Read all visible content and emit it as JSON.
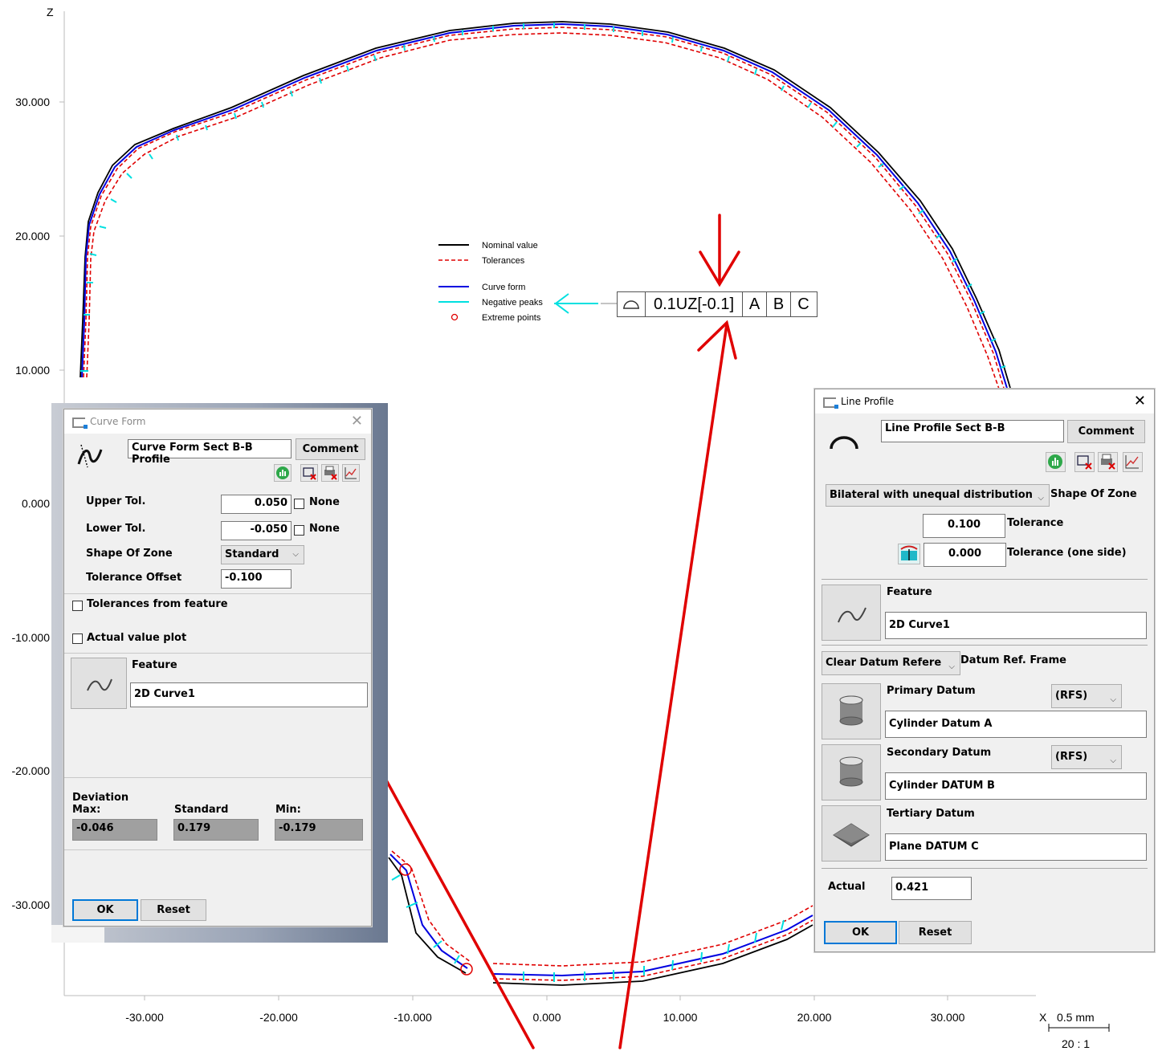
{
  "plot": {
    "axis_z_label": "Z",
    "axis_x_label": "X",
    "y_ticks": [
      "30.000",
      "20.000",
      "10.000",
      "0.000",
      "-10.000",
      "-20.000",
      "-30.000"
    ],
    "x_ticks": [
      "-30.000",
      "-20.000",
      "-10.000",
      "0.000",
      "10.000",
      "20.000",
      "30.000"
    ],
    "scale_bar_label": "0.5 mm",
    "scale_ratio": "20 : 1",
    "legend": [
      {
        "label": "Nominal value",
        "color": "#000000",
        "style": "solid"
      },
      {
        "label": "Tolerances",
        "color": "#e00000",
        "style": "dashed"
      },
      {
        "label": "Curve form",
        "color": "#0000e0",
        "style": "solid"
      },
      {
        "label": "Negative peaks",
        "color": "#00e0e0",
        "style": "solid"
      },
      {
        "label": "Extreme points",
        "color": "#e00000",
        "style": "circle"
      }
    ],
    "fcf": {
      "symbol": "profile-of-line-icon",
      "tolerance": "0.1UZ[-0.1]",
      "datums": [
        "A",
        "B",
        "C"
      ]
    },
    "annotation_color": "#e00000",
    "cyan_arrow_color": "#00e0e0"
  },
  "curve_form": {
    "title": "Curve Form",
    "name": "Curve Form Sect B-B Profile",
    "comment_label": "Comment",
    "upper_tol_label": "Upper Tol.",
    "upper_tol_value": "0.050",
    "lower_tol_label": "Lower Tol.",
    "lower_tol_value": "-0.050",
    "none_label": "None",
    "shape_of_zone_label": "Shape Of Zone",
    "shape_of_zone_value": "Standard",
    "tolerance_offset_label": "Tolerance Offset",
    "tolerance_offset_value": "-0.100",
    "tol_from_feature_label": "Tolerances from feature",
    "actual_plot_label": "Actual value plot",
    "feature_label": "Feature",
    "feature_value": "2D Curve1",
    "deviation_label": "Deviation",
    "max_label": "Max:",
    "std_label": "Standard",
    "min_label": "Min:",
    "max_value": "-0.046",
    "std_value": "0.179",
    "min_value": "-0.179",
    "ok_label": "OK",
    "reset_label": "Reset"
  },
  "line_profile": {
    "title": "Line Profile",
    "name": "Line Profile Sect B-B",
    "comment_label": "Comment",
    "zone_type": "Bilateral with unequal distribution",
    "shape_of_zone_label": "Shape Of Zone",
    "tolerance_value": "0.100",
    "tolerance_label": "Tolerance",
    "tolerance_one_side_value": "0.000",
    "tolerance_one_side_label": "Tolerance (one side)",
    "feature_label": "Feature",
    "feature_value": "2D Curve1",
    "clear_datum_label": "Clear Datum Refere",
    "datum_ref_frame_label": "Datum Ref. Frame",
    "primary_label": "Primary Datum",
    "primary_mod": "(RFS)",
    "primary_value": "Cylinder Datum A",
    "secondary_label": "Secondary Datum",
    "secondary_mod": "(RFS)",
    "secondary_value": "Cylinder DATUM B",
    "tertiary_label": "Tertiary Datum",
    "tertiary_value": "Plane DATUM C",
    "actual_label": "Actual",
    "actual_value": "0.421",
    "ok_label": "OK",
    "reset_label": "Reset"
  }
}
